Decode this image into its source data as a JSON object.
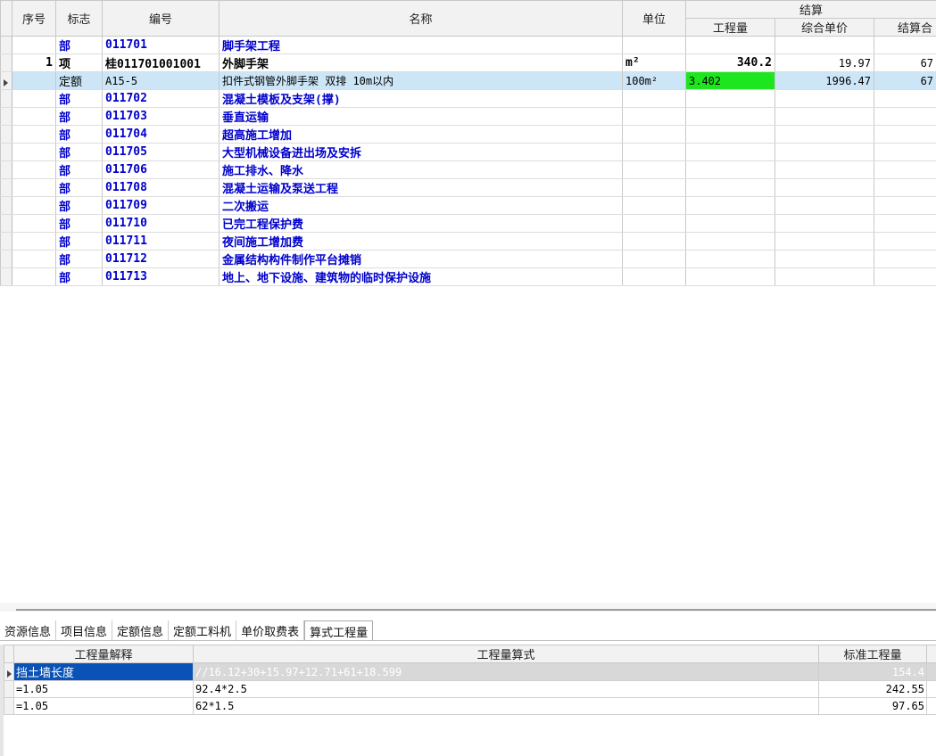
{
  "top_grid": {
    "headers": {
      "seq": "序号",
      "flag": "标志",
      "code": "编号",
      "name": "名称",
      "unit": "单位",
      "group": "结算",
      "qty": "工程量",
      "unit_price": "综合单价",
      "total": "结算合"
    },
    "rows": [
      {
        "seq": "",
        "flag": "部",
        "code": "011701",
        "name": "脚手架工程",
        "unit": "",
        "qty": "",
        "price": "",
        "total": ""
      },
      {
        "seq": "1",
        "flag": "项",
        "code": "桂011701001001",
        "name": "外脚手架",
        "unit": "m²",
        "qty": "340.2",
        "price": "19.97",
        "total": "67"
      },
      {
        "seq": "",
        "flag": "定额",
        "code": "A15-5",
        "name": "扣件式钢管外脚手架 双排 10m以内",
        "unit": "100m²",
        "qty": "3.402",
        "price": "1996.47",
        "total": "67"
      },
      {
        "seq": "",
        "flag": "部",
        "code": "011702",
        "name": "混凝土模板及支架(撑)",
        "unit": "",
        "qty": "",
        "price": "",
        "total": ""
      },
      {
        "seq": "",
        "flag": "部",
        "code": "011703",
        "name": "垂直运输",
        "unit": "",
        "qty": "",
        "price": "",
        "total": ""
      },
      {
        "seq": "",
        "flag": "部",
        "code": "011704",
        "name": "超高施工增加",
        "unit": "",
        "qty": "",
        "price": "",
        "total": ""
      },
      {
        "seq": "",
        "flag": "部",
        "code": "011705",
        "name": "大型机械设备进出场及安拆",
        "unit": "",
        "qty": "",
        "price": "",
        "total": ""
      },
      {
        "seq": "",
        "flag": "部",
        "code": "011706",
        "name": "施工排水、降水",
        "unit": "",
        "qty": "",
        "price": "",
        "total": ""
      },
      {
        "seq": "",
        "flag": "部",
        "code": "011708",
        "name": "混凝土运输及泵送工程",
        "unit": "",
        "qty": "",
        "price": "",
        "total": ""
      },
      {
        "seq": "",
        "flag": "部",
        "code": "011709",
        "name": "二次搬运",
        "unit": "",
        "qty": "",
        "price": "",
        "total": ""
      },
      {
        "seq": "",
        "flag": "部",
        "code": "011710",
        "name": "已完工程保护费",
        "unit": "",
        "qty": "",
        "price": "",
        "total": ""
      },
      {
        "seq": "",
        "flag": "部",
        "code": "011711",
        "name": "夜间施工增加费",
        "unit": "",
        "qty": "",
        "price": "",
        "total": ""
      },
      {
        "seq": "",
        "flag": "部",
        "code": "011712",
        "name": "金属结构构件制作平台摊销",
        "unit": "",
        "qty": "",
        "price": "",
        "total": ""
      },
      {
        "seq": "",
        "flag": "部",
        "code": "011713",
        "name": "地上、地下设施、建筑物的临时保护设施",
        "unit": "",
        "qty": "",
        "price": "",
        "total": ""
      }
    ]
  },
  "tabs": [
    "资源信息",
    "项目信息",
    "定额信息",
    "定额工料机",
    "单价取费表",
    "算式工程量"
  ],
  "active_tab": "算式工程量",
  "bottom_grid": {
    "headers": {
      "explain": "工程量解释",
      "formula": "工程量算式",
      "std_qty": "标准工程量"
    },
    "rows": [
      {
        "explain": "挡土墙长度",
        "formula": "//16.12+30+15.97+12.71+61+18.599",
        "std_qty": "154.4"
      },
      {
        "explain": "=1.05",
        "formula": "92.4*2.5",
        "std_qty": "242.55"
      },
      {
        "explain": "=1.05",
        "formula": "62*1.5",
        "std_qty": "97.65"
      }
    ]
  },
  "colors": {
    "selected_row": "#cde6f7",
    "qty_highlight": "#1ee61e",
    "blue_text": "#0000cc",
    "explain_highlight": "#0a52b5"
  }
}
